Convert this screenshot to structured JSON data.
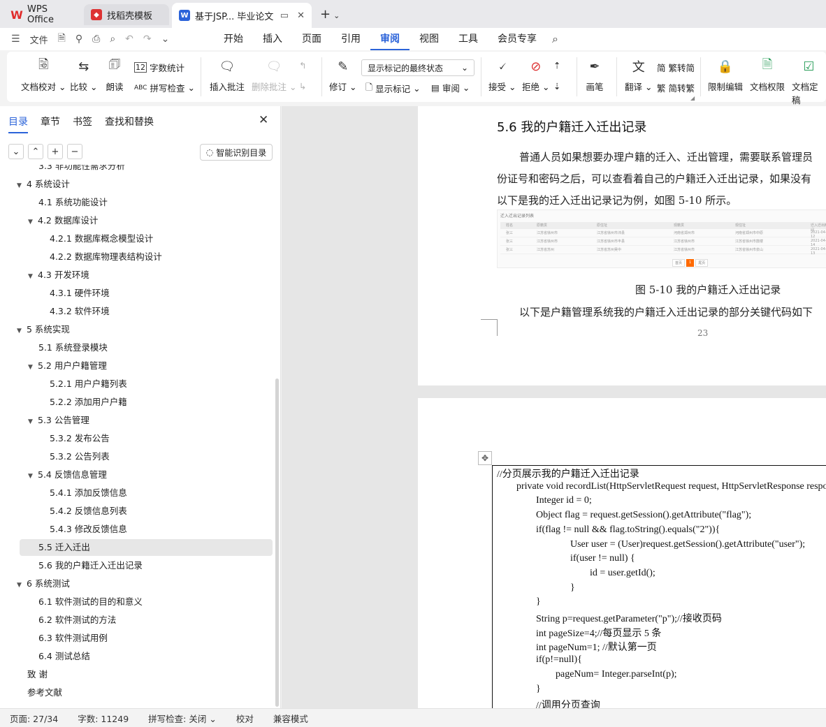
{
  "titlebar": {
    "tabs": [
      {
        "label": "WPS Office"
      },
      {
        "label": "找稻壳模板"
      },
      {
        "label": "基于JSP... 毕业论文"
      }
    ]
  },
  "menubar": {
    "file_label": "文件",
    "tabs": [
      "开始",
      "插入",
      "页面",
      "引用",
      "审阅",
      "视图",
      "工具",
      "会员专享"
    ],
    "active_tab": "审阅"
  },
  "ribbon": {
    "doc_proofread": "文档校对",
    "compare": "比较",
    "read_aloud": "朗读",
    "word_count": "字数统计",
    "spell_check": "拼写检查",
    "insert_comment": "插入批注",
    "delete_comment": "删除批注",
    "revise": "修订",
    "markup_state": "显示标记的最终状态",
    "show_markup": "显示标记",
    "review": "审阅",
    "accept": "接受",
    "reject": "拒绝",
    "pen": "画笔",
    "translate": "翻译",
    "trad_to_simp": "繁转简",
    "simp_to_trad": "简转繁",
    "restrict_edit": "限制编辑",
    "doc_permission": "文档权限",
    "doc_finalize": "文档定稿"
  },
  "nav": {
    "tabs": [
      "目录",
      "章节",
      "书签",
      "查找和替换"
    ],
    "active_tab": "目录",
    "smart_toc": "智能识别目录",
    "toc": [
      {
        "label": "3.3 非功能性需求分析",
        "level": 2,
        "arrow": ""
      },
      {
        "label": "4  系统设计",
        "level": 1,
        "arrow": "▼"
      },
      {
        "label": "4.1 系统功能设计",
        "level": 2,
        "arrow": ""
      },
      {
        "label": "4.2 数据库设计",
        "level": 2,
        "arrow": "▼"
      },
      {
        "label": "4.2.1 数据库概念模型设计",
        "level": 3,
        "arrow": ""
      },
      {
        "label": "4.2.2 数据库物理表结构设计",
        "level": 3,
        "arrow": ""
      },
      {
        "label": "4.3 开发环境",
        "level": 2,
        "arrow": "▼"
      },
      {
        "label": "4.3.1  硬件环境",
        "level": 3,
        "arrow": ""
      },
      {
        "label": "4.3.2  软件环境",
        "level": 3,
        "arrow": ""
      },
      {
        "label": "5  系统实现",
        "level": 1,
        "arrow": "▼"
      },
      {
        "label": "5.1  系统登录模块",
        "level": 2,
        "arrow": ""
      },
      {
        "label": "5.2  用户户籍管理",
        "level": 2,
        "arrow": "▼"
      },
      {
        "label": "5.2.1  用户户籍列表",
        "level": 3,
        "arrow": ""
      },
      {
        "label": "5.2.2  添加用户户籍",
        "level": 3,
        "arrow": ""
      },
      {
        "label": "5.3  公告管理",
        "level": 2,
        "arrow": "▼"
      },
      {
        "label": "5.3.2  发布公告",
        "level": 3,
        "arrow": ""
      },
      {
        "label": "5.3.2  公告列表",
        "level": 3,
        "arrow": ""
      },
      {
        "label": "5.4  反馈信息管理",
        "level": 2,
        "arrow": "▼"
      },
      {
        "label": "5.4.1  添加反馈信息",
        "level": 3,
        "arrow": ""
      },
      {
        "label": "5.4.2  反馈信息列表",
        "level": 3,
        "arrow": ""
      },
      {
        "label": "5.4.3  修改反馈信息",
        "level": 3,
        "arrow": ""
      },
      {
        "label": "5.5  迁入迁出",
        "level": 2,
        "arrow": "",
        "selected": true
      },
      {
        "label": "5.6  我的户籍迁入迁出记录",
        "level": 2,
        "arrow": ""
      },
      {
        "label": "6  系统测试",
        "level": 1,
        "arrow": "▼"
      },
      {
        "label": "6.1 软件测试的目的和意义",
        "level": 2,
        "arrow": ""
      },
      {
        "label": "6.2 软件测试的方法",
        "level": 2,
        "arrow": ""
      },
      {
        "label": "6.3  软件测试用例",
        "level": 2,
        "arrow": ""
      },
      {
        "label": "6.4 测试总结",
        "level": 2,
        "arrow": ""
      },
      {
        "label": "致  谢",
        "level": 1,
        "arrow": ""
      },
      {
        "label": "参考文献",
        "level": 1,
        "arrow": ""
      }
    ]
  },
  "document": {
    "heading": "5.6  我的户籍迁入迁出记录",
    "paragraph_lines": [
      "普通人员如果想要办理户籍的迁入、迁出管理，需要联系管理员",
      "份证号和密码之后，可以查看着自己的户籍迁入迁出记录，如果没有",
      "以下是我的迁入迁出记录记为例，如图 5-10 所示。"
    ],
    "figure": {
      "title": "迁入迁出记录列表",
      "columns": [
        "姓名",
        "原籍贯",
        "原住址",
        "现籍贯",
        "现住址",
        "迁入迁出时间"
      ],
      "rows": [
        [
          "张三",
          "江苏省徐州市",
          "江苏省徐州市沛县",
          "河南省郑州市",
          "河南省郑州市中原",
          "2021-04-12"
        ],
        [
          "张三",
          "江苏省徐州市",
          "江苏省徐州市丰县",
          "江苏省徐州市",
          "江苏省徐州市鼓楼",
          "2021-04-14"
        ],
        [
          "张三",
          "江苏省苏州",
          "江苏省苏州吴中",
          "江苏省徐州市",
          "江苏省徐州市泉山",
          "2021-04-13"
        ]
      ],
      "pager": [
        "首页",
        "1",
        "尾页"
      ]
    },
    "caption": "图 5-10  我的户籍迁入迁出记录",
    "after_caption": "以下是户籍管理系统我的户籍迁入迁出记录的部分关键代码如下",
    "page_number": "23",
    "code_lines": [
      "//分页展示我的户籍迁入迁出记录",
      "private void recordList(HttpServletRequest request, HttpServletResponse respo",
      "Integer id = 0;",
      "Object flag = request.getSession().getAttribute(\"flag\");",
      "if(flag != null && flag.toString().equals(\"2\")){",
      "User user = (User)request.getSession().getAttribute(\"user\");",
      "if(user != null) {",
      "id = user.getId();",
      "}",
      "}",
      "String p=request.getParameter(\"p\");//接收页码",
      "int pageSize=4;//每页显示 5 条",
      "int pageNum=1; //默认第一页",
      "if(p!=null){",
      "pageNum= Integer.parseInt(p);",
      "}",
      "//调用分页查询"
    ]
  },
  "status": {
    "page": "页面: 27/34",
    "words": "字数: 11249",
    "spell": "拼写检查: 关闭",
    "proofread": "校对",
    "compat": "兼容模式"
  },
  "colors": {
    "accent": "#2b63d9",
    "pager_active": "#ff6a00",
    "wps_red": "#e02b2b"
  }
}
